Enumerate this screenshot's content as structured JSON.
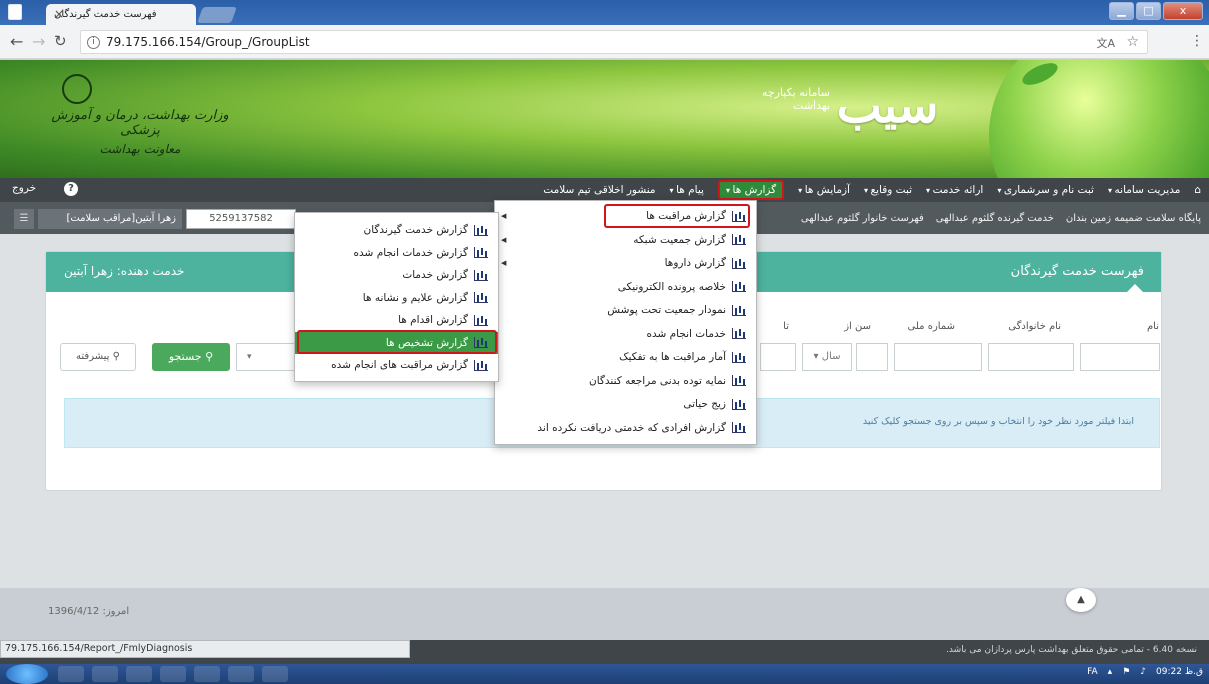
{
  "browser": {
    "tab_title": "فهرست خدمت گیرندگان",
    "tab_close": "×",
    "url": "79.175.166.154/Group_/GroupList",
    "status_url": "79.175.166.154/Report_/FmlyDiagnosis",
    "icons": {
      "back": "back-arrow-icon",
      "forward": "forward-arrow-icon",
      "reload": "reload-icon",
      "info": "info-icon",
      "star": "bookmark-star-icon",
      "menu": "kebab-menu-icon",
      "translate": "translate-icon"
    },
    "window_controls": {
      "minimize": "▁",
      "maximize": "□",
      "close": "x"
    }
  },
  "banner": {
    "ministry_line1": "وزارت بهداشت، درمان و آموزش پزشکی",
    "ministry_line2": "معاونت بهداشت",
    "logo_text": "سیب",
    "logo_sub": "سامانه یکپارچه بهداشت"
  },
  "topnav": {
    "items": [
      {
        "label": "مدیریت سامانه",
        "caret": true
      },
      {
        "label": "ثبت نام و سرشماری",
        "caret": true
      },
      {
        "label": "ارائه خدمت",
        "caret": true
      },
      {
        "label": "ثبت وقایع",
        "caret": true
      },
      {
        "label": "آزمایش ها",
        "caret": true
      },
      {
        "label": "گزارش ها",
        "caret": true,
        "active": true
      },
      {
        "label": "پیام ها",
        "caret": true
      },
      {
        "label": "منشور اخلاقی تیم سلامت",
        "caret": false
      }
    ],
    "logout": "خروج",
    "help": "?"
  },
  "subnav": {
    "items": [
      "پایگاه سلامت ضمیمه زمین بندان",
      "خدمت گیرنده گلثوم عبدالهی",
      "فهرست خانوار گلثوم عبدالهی"
    ],
    "national_id": "5259137582",
    "person": "زهرا آبتین[مراقب سلامت]"
  },
  "panel": {
    "title": "فهرست خدمت گیرندگان",
    "provider_label": "خدمت دهنده: زهرا آبتین",
    "filters": {
      "first_name": "نام",
      "last_name": "نام خانوادگی",
      "national_code": "شماره ملی",
      "age_from": "سن از",
      "to": "تا",
      "unit": "سال"
    },
    "search_button": "جستجو",
    "advanced_button": "پیشرفته",
    "info_text": "ابتدا فیلتر مورد نظر خود را انتخاب و سپس بر روی جستجو کلیک کنید"
  },
  "reports_menu": [
    {
      "label": "گزارش مراقبت ها",
      "sub": true
    },
    {
      "label": "گزارش جمعیت شبکه",
      "sub": true
    },
    {
      "label": "گزارش داروها",
      "sub": true
    },
    {
      "label": "خلاصه پرونده الکترونیکی",
      "sub": false
    },
    {
      "label": "نمودار جمعیت تحت پوشش",
      "sub": false
    },
    {
      "label": "خدمات انجام شده",
      "sub": false
    },
    {
      "label": "آمار مراقبت ها به تفکیک",
      "sub": false
    },
    {
      "label": "نمایه توده بدنی مراجعه کنندگان",
      "sub": false
    },
    {
      "label": "زیج حیاتی",
      "sub": false
    },
    {
      "label": "گزارش افرادی که خدمتی دریافت نکرده اند",
      "sub": false
    }
  ],
  "care_submenu": [
    {
      "label": "گزارش خدمت گیرندگان"
    },
    {
      "label": "گزارش خدمات انجام شده"
    },
    {
      "label": "گزارش خدمات"
    },
    {
      "label": "گزارش علایم و نشانه ها"
    },
    {
      "label": "گزارش اقدام ها"
    },
    {
      "label": "گزارش تشخیص ها",
      "highlighted": true
    },
    {
      "label": "گزارش مراقبت های انجام شده"
    }
  ],
  "footer": {
    "date": "امروز: 1396/4/12",
    "copyright": "نسخه 6.40 - تمامی حقوق متعلق بهداشت پارس پردازان می باشد."
  },
  "taskbar": {
    "lang": "FA",
    "time": "09:22 ق.ظ"
  }
}
